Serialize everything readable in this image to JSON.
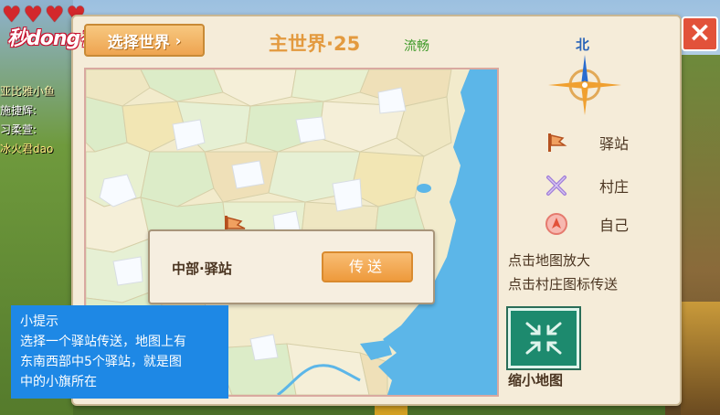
{
  "overlay": {
    "logo": "秒dong视频",
    "hearts": 4
  },
  "chat": [
    "亚比雅小鱼",
    "施捷辉:",
    "习柔萱:",
    "冰火君dao"
  ],
  "panel": {
    "world_button": "选择世界",
    "title": "主世界·25",
    "status": "流畅",
    "close": "×"
  },
  "teleport": {
    "station_name": "中部·驿站",
    "button": "传送"
  },
  "legend": {
    "north": "北",
    "station": "驿站",
    "village": "村庄",
    "self": "自己",
    "hint1": "点击地图放大",
    "hint2": "点击村庄图标传送",
    "minimize": "缩小地图"
  },
  "tip": {
    "title": "小提示",
    "lines": [
      "选择一个驿站传送，地图上有",
      "东南西部中5个驿站，就是图",
      "中的小旗所在"
    ]
  },
  "colors": {
    "accent_orange": "#ee9a3c",
    "close_red": "#e2523a",
    "tip_blue": "#1e88e5",
    "status_green": "#3f9a2a",
    "sea": "#5cb6e8"
  }
}
